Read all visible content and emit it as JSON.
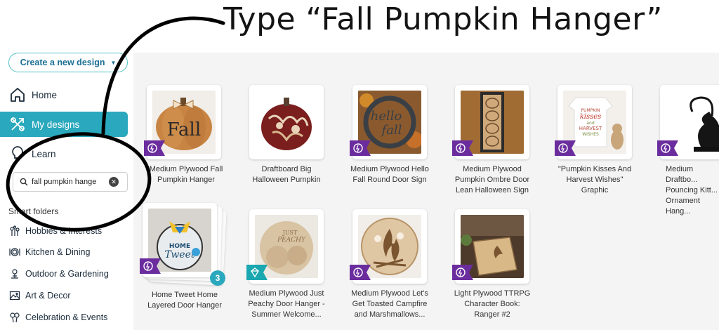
{
  "annotation": {
    "title": "Type “Fall Pumpkin Hanger”"
  },
  "sidebar": {
    "create_button": "Create a new design",
    "nav": [
      {
        "label": "Home",
        "icon": "home-icon"
      },
      {
        "label": "My designs",
        "icon": "designs-icon",
        "active": true
      },
      {
        "label": "Learn",
        "icon": "lightbulb-icon"
      }
    ],
    "search": {
      "value": "fall pumpkin hange",
      "placeholder": "Search"
    },
    "smart_folders_label": "Smart folders",
    "folders": [
      {
        "label": "Hobbies & Interests",
        "icon": "hobbies-icon"
      },
      {
        "label": "Kitchen & Dining",
        "icon": "kitchen-icon"
      },
      {
        "label": "Outdoor & Gardening",
        "icon": "outdoor-icon"
      },
      {
        "label": "Art & Decor",
        "icon": "art-icon"
      },
      {
        "label": "Celebration & Events",
        "icon": "celebration-icon"
      }
    ]
  },
  "designs": [
    {
      "title": "Medium Plywood Fall Pumpkin Hanger",
      "badge": "purple"
    },
    {
      "title": "Draftboard Big Halloween Pumpkin",
      "badge": "none"
    },
    {
      "title": "Medium Plywood Hello Fall Round Door Sign",
      "badge": "purple"
    },
    {
      "title": "Medium Plywood Pumpkin Ombre Door Lean Halloween Sign",
      "badge": "purple"
    },
    {
      "title": "\"Pumpkin Kisses And Harvest Wishes\" Graphic",
      "badge": "purple"
    },
    {
      "title": "Medium Draftbo... Pouncing Kitt... Ornament Hang...",
      "badge": "purple"
    },
    {
      "title": "Home Tweet Home Layered Door Hanger",
      "badge": "purple",
      "count": "3"
    },
    {
      "title": "Medium Plywood Just Peachy Door Hanger - Summer Welcome...",
      "badge": "teal"
    },
    {
      "title": "Medium Plywood Let's Get Toasted Campfire and Marshmallows...",
      "badge": "purple"
    },
    {
      "title": "Light Plywood TTRPG Character Book: Ranger #2",
      "badge": "purple"
    }
  ],
  "thumb_text": {
    "fall": "Fall",
    "hello": "hello",
    "fall_small": "fall",
    "kisses": "PUMPKIN",
    "kisses2": "kisses",
    "kisses3": "and",
    "kisses4": "HARVEST",
    "kisses5": "WISHES",
    "home": "HOME",
    "tweet": "Tweet",
    "just": "JUST",
    "peachy": "PEACHY"
  },
  "colors": {
    "accent": "#2aa8bd",
    "badge_purple": "#6b2d9e",
    "badge_teal": "#1ba7b0",
    "link": "#1a6f96"
  }
}
